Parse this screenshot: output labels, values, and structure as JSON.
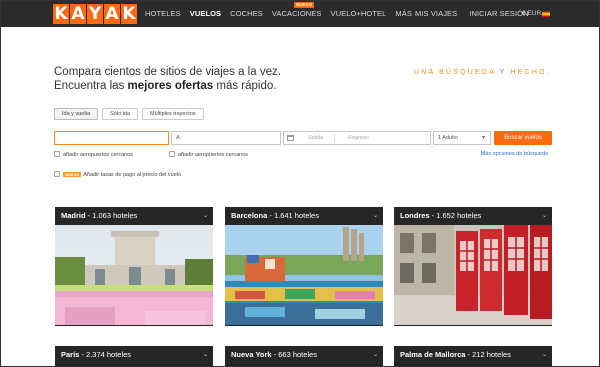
{
  "brand": {
    "letters": [
      "K",
      "A",
      "Y",
      "A",
      "K"
    ],
    "color": "#ff690f"
  },
  "nav": {
    "items": [
      {
        "label": "HOTELES",
        "active": false
      },
      {
        "label": "VUELOS",
        "active": true
      },
      {
        "label": "COCHES",
        "active": false
      },
      {
        "label": "VACACIONES",
        "active": false,
        "badge": "NUEVO"
      },
      {
        "label": "VUELO+HOTEL",
        "active": false
      },
      {
        "label": "MÁS",
        "active": false
      }
    ],
    "right": {
      "trips": "MIS VIAJES",
      "login": "INICIAR SESIÓN",
      "currency": "€ EUR"
    }
  },
  "hero": {
    "line1": "Compara cientos de sitios de viajes a la vez.",
    "line2_prefix": "Encuentra las ",
    "line2_bold": "mejores ofertas",
    "line2_suffix": " más rápido.",
    "slogan_a": "UNA BÚSQUEDA",
    "slogan_b": " Y ",
    "slogan_c": "HECHO."
  },
  "trip_tabs": [
    "Ida y vuelta",
    "Sólo ida",
    "Múltiples trayectos"
  ],
  "search": {
    "origin_value": "",
    "destination_prefix": "A",
    "depart_placeholder": "Salida",
    "return_placeholder": "Regreso",
    "travelers": "1 Adulto",
    "button": "Buscar vuelos"
  },
  "options": {
    "nearby_origin": "añadir aeropuertos cercanos",
    "nearby_dest": "añadir aeropuertos cercanos",
    "more": "Más opciones de búsqueda",
    "fee_badge": "NUEVO",
    "fee_label": "Añadir tasas de pago al precio del vuelo"
  },
  "destinations": [
    {
      "city": "Madrid",
      "count": " - 1.063 hoteles"
    },
    {
      "city": "Barcelona",
      "count": " - 1.641 hoteles"
    },
    {
      "city": "Londres",
      "count": " - 1.652 hoteles"
    },
    {
      "city": "París",
      "count": " - 2.374 hoteles"
    },
    {
      "city": "Nueva York",
      "count": " - 663 hoteles"
    },
    {
      "city": "Palma de Mallorca",
      "count": " - 212 hoteles"
    }
  ]
}
